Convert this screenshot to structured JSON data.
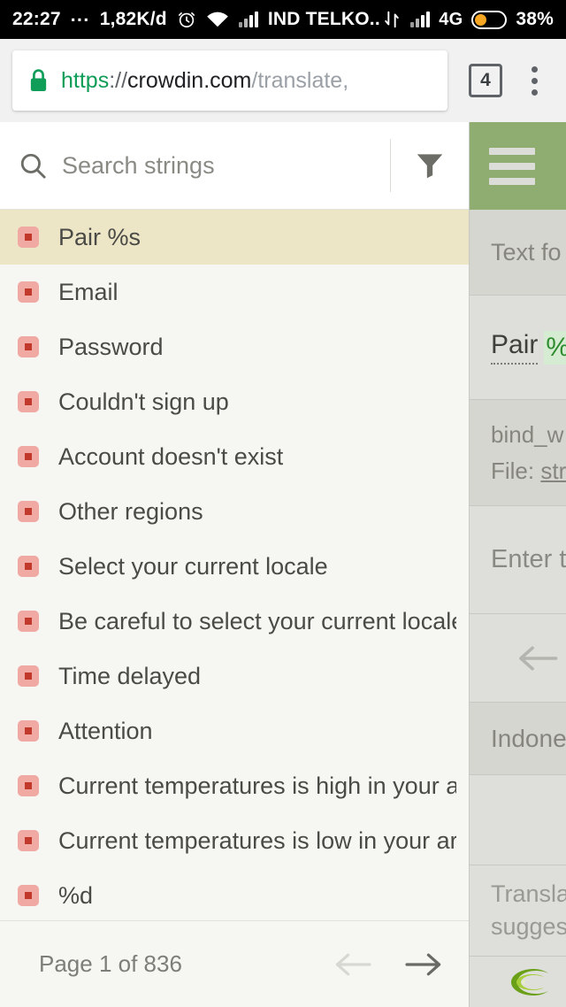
{
  "status_bar": {
    "time": "22:27",
    "overflow_dots": "...",
    "data_rate": "1,82K/d",
    "alarm_icon": "alarm-clock-icon",
    "wifi_icon": "wifi-icon",
    "signal_icon": "signal-bars-icon",
    "carrier": "IND TELKO..",
    "data_transfer_icon": "data-transfer-icon",
    "network_type": "4G",
    "battery_icon": "battery-icon",
    "battery_percent": "38%",
    "battery_level": 38
  },
  "browser": {
    "lock_icon": "lock-icon",
    "url_scheme": "https",
    "url_separator": "://",
    "url_host": "crowdin.com",
    "url_path": "/translate,",
    "tab_count": "4",
    "menu_icon": "kebab-menu-icon"
  },
  "search": {
    "icon": "search-icon",
    "placeholder": "Search strings",
    "value": "",
    "filter_icon": "filter-funnel-icon"
  },
  "strings_list": {
    "items": [
      {
        "label": "Pair %s",
        "status_icon": "untranslated-badge-icon",
        "selected": true
      },
      {
        "label": "Email",
        "status_icon": "untranslated-badge-icon",
        "selected": false
      },
      {
        "label": "Password",
        "status_icon": "untranslated-badge-icon",
        "selected": false
      },
      {
        "label": "Couldn't sign up",
        "status_icon": "untranslated-badge-icon",
        "selected": false
      },
      {
        "label": "Account doesn't exist",
        "status_icon": "untranslated-badge-icon",
        "selected": false
      },
      {
        "label": "Other regions",
        "status_icon": "untranslated-badge-icon",
        "selected": false
      },
      {
        "label": "Select your current locale",
        "status_icon": "untranslated-badge-icon",
        "selected": false
      },
      {
        "label": "Be careful to select your current locale, ...",
        "status_icon": "untranslated-badge-icon",
        "selected": false
      },
      {
        "label": "Time delayed",
        "status_icon": "untranslated-badge-icon",
        "selected": false
      },
      {
        "label": "Attention",
        "status_icon": "untranslated-badge-icon",
        "selected": false
      },
      {
        "label": "Current temperatures is high in your ar...",
        "status_icon": "untranslated-badge-icon",
        "selected": false
      },
      {
        "label": "Current temperatures is low in your are...",
        "status_icon": "untranslated-badge-icon",
        "selected": false
      },
      {
        "label": "%d",
        "status_icon": "untranslated-badge-icon",
        "selected": false
      }
    ]
  },
  "pager": {
    "label": "Page 1 of 836",
    "prev_icon": "arrow-left-icon",
    "next_icon": "arrow-right-icon",
    "prev_enabled": false,
    "next_enabled": true
  },
  "editor_panel": {
    "menu_icon": "hamburger-menu-icon",
    "source_label": "Text fo",
    "source_word": "Pair",
    "source_variable": "%",
    "context_key": "bind_w",
    "file_label": "File:",
    "file_name": "str",
    "translation_placeholder": "Enter t",
    "back_icon": "arrow-left-icon",
    "target_language": "Indone",
    "suggestions_line1": "Transla",
    "suggestions_line2": "suggest",
    "logo_icon": "crowdin-logo-icon"
  },
  "colors": {
    "status_bar_bg": "#000000",
    "browser_bg": "#f1f1f1",
    "accent_green": "#8fad70",
    "selected_row_bg": "#ece5c6",
    "list_bg": "#f6f6f3",
    "panel_bg": "#dededa",
    "panel_alt_bg": "#d6d6d1",
    "badge_bg": "#f1a9a4",
    "badge_dot": "#c0392b",
    "https_green": "#0f9d58",
    "battery_orange": "#f5a623",
    "variable_green": "#2e8b2e"
  }
}
